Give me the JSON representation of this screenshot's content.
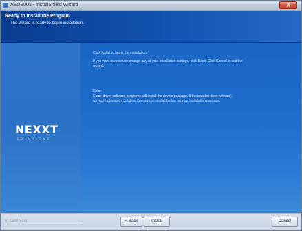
{
  "window": {
    "title": "ASUS001 - InstallShield Wizard",
    "close_label": "X"
  },
  "header": {
    "title": "Ready to Install the Program",
    "subtitle": "The wizard is ready to begin installation."
  },
  "logo": {
    "text": "NEXXT",
    "subtext": "SOLUTIONS"
  },
  "content": {
    "line1": "Click Install to begin the installation.",
    "line2": "If you want to review or change any of your installation settings, click Back. Click Cancel to exit the",
    "line3": "wizard.",
    "note_heading": "Note:",
    "note_line1": "Some driver software programs will install the device package. If the installer does not work",
    "note_line2": "correctly, please try to follow the device reinstall button on your installation package."
  },
  "footer": {
    "brand": "InstallShield",
    "back_label": "< Back",
    "install_label": "Install",
    "cancel_label": "Cancel"
  }
}
